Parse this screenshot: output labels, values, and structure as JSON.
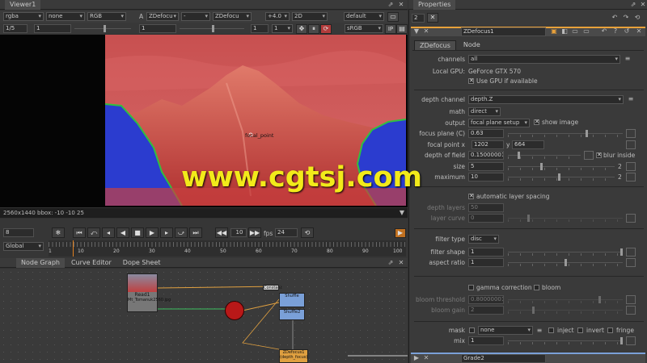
{
  "viewer": {
    "tab": "Viewer1",
    "channels_a": "rgba",
    "channels_b": "none",
    "colorspace_combo": "RGB",
    "a_label": "A",
    "input_a": "ZDefocu",
    "dash": "-",
    "input_b": "ZDefocu",
    "zoom": "+4.0",
    "mode": "2D",
    "lut": "default",
    "frame_range": "1/5",
    "frame": "1",
    "gain": "1",
    "gamma": "1",
    "view_lut": "sRGB",
    "info_bar": "2560x1440 bbox: -10 -10 25",
    "overlay_label": "focal_point"
  },
  "timeline": {
    "frame": "8",
    "fps_label": "fps",
    "fps": "24",
    "step": "10",
    "range_mode": "Global",
    "ruler": [
      "1",
      "10",
      "20",
      "30",
      "40",
      "50",
      "60",
      "70",
      "80",
      "90",
      "100"
    ]
  },
  "nodegraph": {
    "tabs": [
      "Node Graph",
      "Curve Editor",
      "Dope Sheet"
    ],
    "nodes": {
      "read": "Read1",
      "read_file": "Mt_Tomanuk2560.jpg",
      "constant": "Constant",
      "shuffle": "Shuffle",
      "shuffle2": "Shuffle2",
      "zdefocus": "ZDefocus1",
      "zdefocus_sub": "(depth_focus)"
    }
  },
  "properties": {
    "title": "Properties",
    "count": "2",
    "node_name": "ZDefocus1",
    "tabs": [
      "ZDefocus",
      "Node"
    ],
    "channels_label": "channels",
    "channels_value": "all",
    "local_gpu_label": "Local GPU:",
    "local_gpu_value": "GeForce GTX 570",
    "use_gpu_label": "Use GPU if available",
    "depth_channel_label": "depth channel",
    "depth_channel_value": "depth.Z",
    "math_label": "math",
    "math_value": "direct",
    "output_label": "output",
    "output_value": "focal plane setup",
    "show_image_label": "show image",
    "focus_plane_label": "focus plane (C)",
    "focus_plane_value": "0.63",
    "focal_point_label": "focal point x",
    "focal_point_x": "1202",
    "focal_point_y_label": "y",
    "focal_point_y": "664",
    "depth_of_field_label": "depth of field",
    "depth_of_field_value": "0.15000001",
    "blur_inside_label": "blur inside",
    "size_label": "size",
    "size_value": "5",
    "maximum_label": "maximum",
    "maximum_value": "10",
    "auto_layer_label": "automatic layer spacing",
    "depth_layers_label": "depth layers",
    "depth_layers_value": "50",
    "layer_curve_label": "layer curve",
    "layer_curve_value": "0",
    "filter_type_label": "filter type",
    "filter_type_value": "disc",
    "filter_shape_label": "filter shape",
    "filter_shape_value": "1",
    "aspect_ratio_label": "aspect ratio",
    "aspect_ratio_value": "1",
    "gamma_correction_label": "gamma correction",
    "bloom_label": "bloom",
    "bloom_threshold_label": "bloom threshold",
    "bloom_threshold_value": "0.80000001",
    "bloom_gain_label": "bloom gain",
    "bloom_gain_value": "2",
    "mask_label": "mask",
    "mask_value": "none",
    "inject_label": "inject",
    "invert_label": "invert",
    "fringe_label": "fringe",
    "mix_label": "mix",
    "mix_value": "1",
    "next_panel": "Grade2",
    "slider_ticks": [
      "0.1",
      "0.2",
      "0.3",
      "0.4",
      "0.5",
      "0.6",
      "0.7",
      "0.8",
      "0.9"
    ]
  },
  "watermark": "www.cgtsj.com",
  "colors": {
    "focus_red": "#d23a3a",
    "out_of_focus_blue": "#2b3ccf",
    "watermark_yellow": "#f2ea1a",
    "properties_accent": "#e8a13a"
  }
}
